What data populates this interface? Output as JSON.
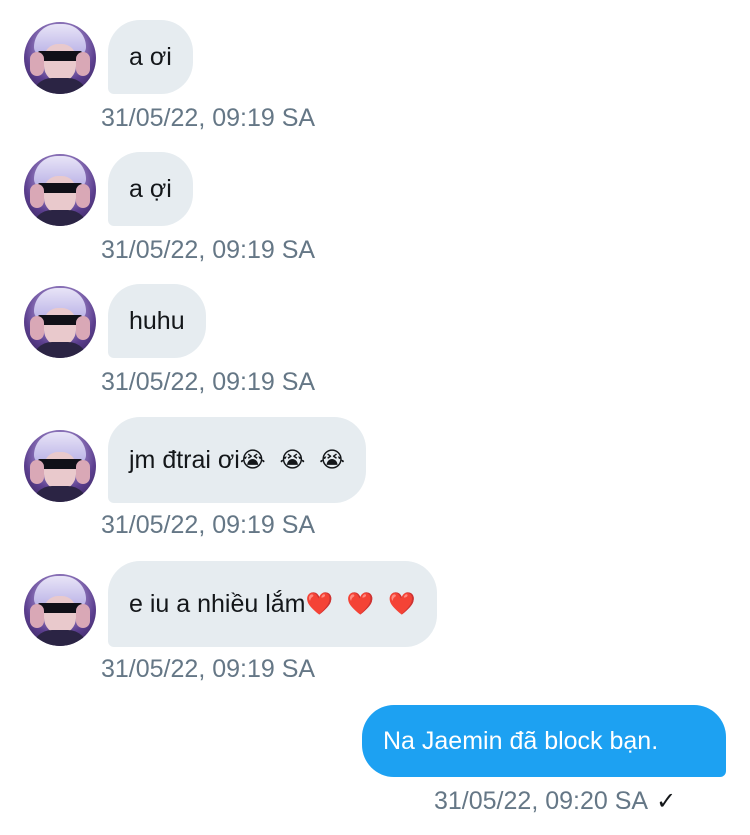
{
  "thread": {
    "messages": [
      {
        "sender": "other",
        "text": "a ơi",
        "emojis": [],
        "timestamp": "31/05/22, 09:19 SA"
      },
      {
        "sender": "other",
        "text": "a ợi",
        "emojis": [],
        "timestamp": "31/05/22, 09:19 SA"
      },
      {
        "sender": "other",
        "text": "huhu",
        "emojis": [],
        "timestamp": "31/05/22, 09:19 SA"
      },
      {
        "sender": "other",
        "text": "jm đtrai ơi",
        "emojis": [
          "😭",
          "😭",
          "😭"
        ],
        "timestamp": "31/05/22, 09:19 SA"
      },
      {
        "sender": "other",
        "text": "e iu a nhiều lắm",
        "emojis": [
          "❤️",
          "❤️",
          "❤️"
        ],
        "timestamp": "31/05/22, 09:19 SA"
      }
    ],
    "sent": {
      "text": "Na Jaemin đã block bạn.",
      "timestamp": "31/05/22, 09:20 SA",
      "status_icon": "✓"
    }
  },
  "colors": {
    "received_bubble": "#e6ecf0",
    "sent_bubble": "#1da1f2",
    "timestamp": "#657786",
    "text": "#14171a"
  },
  "icons": {
    "avatar": "avatar-photo",
    "delivered": "check-icon"
  }
}
